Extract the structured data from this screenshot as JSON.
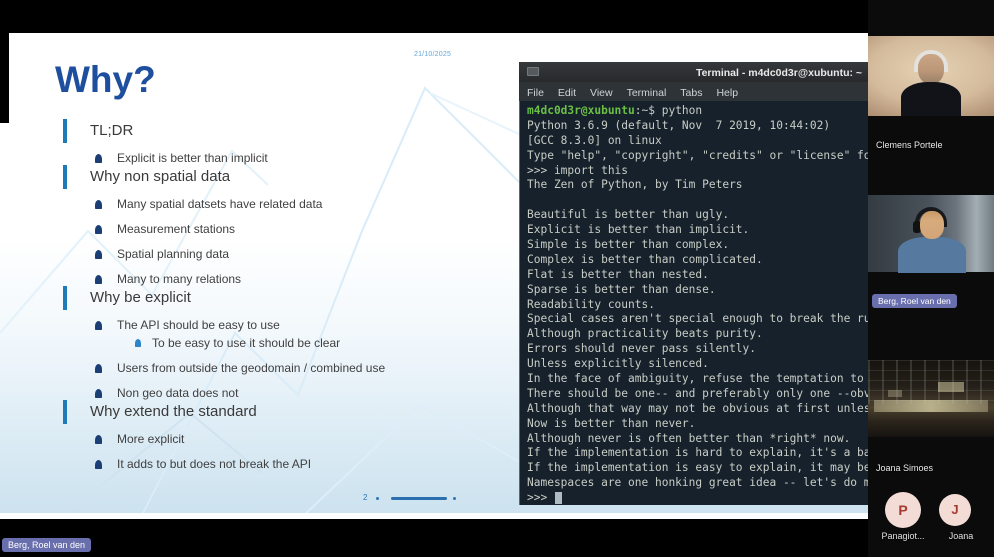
{
  "slide": {
    "date": "21/10/2025",
    "title": "Why?",
    "page_number": "2",
    "items": [
      {
        "type": "header",
        "text": "TL;DR"
      },
      {
        "type": "bullet",
        "text": "Explicit is better than implicit"
      },
      {
        "type": "header",
        "text": "Why non spatial data"
      },
      {
        "type": "bullet",
        "text": "Many spatial datsets have related data"
      },
      {
        "type": "bullet",
        "text": "Measurement stations"
      },
      {
        "type": "bullet",
        "text": "Spatial planning data"
      },
      {
        "type": "bullet",
        "text": "Many to many relations"
      },
      {
        "type": "header",
        "text": "Why be explicit"
      },
      {
        "type": "bullet",
        "text": "The API should be easy to use"
      },
      {
        "type": "subbullet",
        "text": "To be easy to use it should be clear"
      },
      {
        "type": "bullet",
        "text": "Users from outside the geodomain / combined use"
      },
      {
        "type": "bullet",
        "text": "Non geo data does not"
      },
      {
        "type": "header",
        "text": "Why extend the standard"
      },
      {
        "type": "bullet",
        "text": "More explicit"
      },
      {
        "type": "bullet",
        "text": "It adds to but does not break the API"
      }
    ]
  },
  "terminal": {
    "title": "Terminal - m4dc0d3r@xubuntu: ~",
    "menu": [
      "File",
      "Edit",
      "View",
      "Terminal",
      "Tabs",
      "Help"
    ],
    "prompt_user": "m4dc0d3r@xubuntu",
    "prompt_rest": ":~$ python",
    "lines": [
      "Python 3.6.9 (default, Nov  7 2019, 10:44:02)",
      "[GCC 8.3.0] on linux",
      "Type \"help\", \"copyright\", \"credits\" or \"license\" fo",
      ">>> import this",
      "The Zen of Python, by Tim Peters",
      "",
      "Beautiful is better than ugly.",
      "Explicit is better than implicit.",
      "Simple is better than complex.",
      "Complex is better than complicated.",
      "Flat is better than nested.",
      "Sparse is better than dense.",
      "Readability counts.",
      "Special cases aren't special enough to break the ru",
      "Although practicality beats purity.",
      "Errors should never pass silently.",
      "Unless explicitly silenced.",
      "In the face of ambiguity, refuse the temptation to",
      "There should be one-- and preferably only one --obv",
      "Although that way may not be obvious at first unles",
      "Now is better than never.",
      "Although never is often better than *right* now.",
      "If the implementation is hard to explain, it's a ba",
      "If the implementation is easy to explain, it may be",
      "Namespaces are one honking great idea -- let's do m"
    ],
    "last_prompt": ">>> "
  },
  "participants": [
    {
      "name": "Clemens Portele"
    },
    {
      "name": "Berg, Roel van den"
    },
    {
      "name": "Joana Simoes"
    }
  ],
  "avatars": [
    {
      "initial": "P",
      "label": "Panagiot..."
    },
    {
      "initial": "J",
      "label": "Joana"
    }
  ],
  "presenter_overlay": "Berg, Roel van den",
  "colors": {
    "slide_title_blue": "#1d4f9e",
    "section_bar_blue": "#1f7ab8",
    "bullet_navy": "#1b3f74",
    "subbullet_blue": "#2d84c6",
    "terminal_bg": "#16212c",
    "terminal_text": "#c8cdc5",
    "terminal_green": "#6abf45",
    "pill_purple": "#7277bc",
    "avatar_pink": "#f3dbd6",
    "avatar_letter_red": "#a63b30"
  }
}
